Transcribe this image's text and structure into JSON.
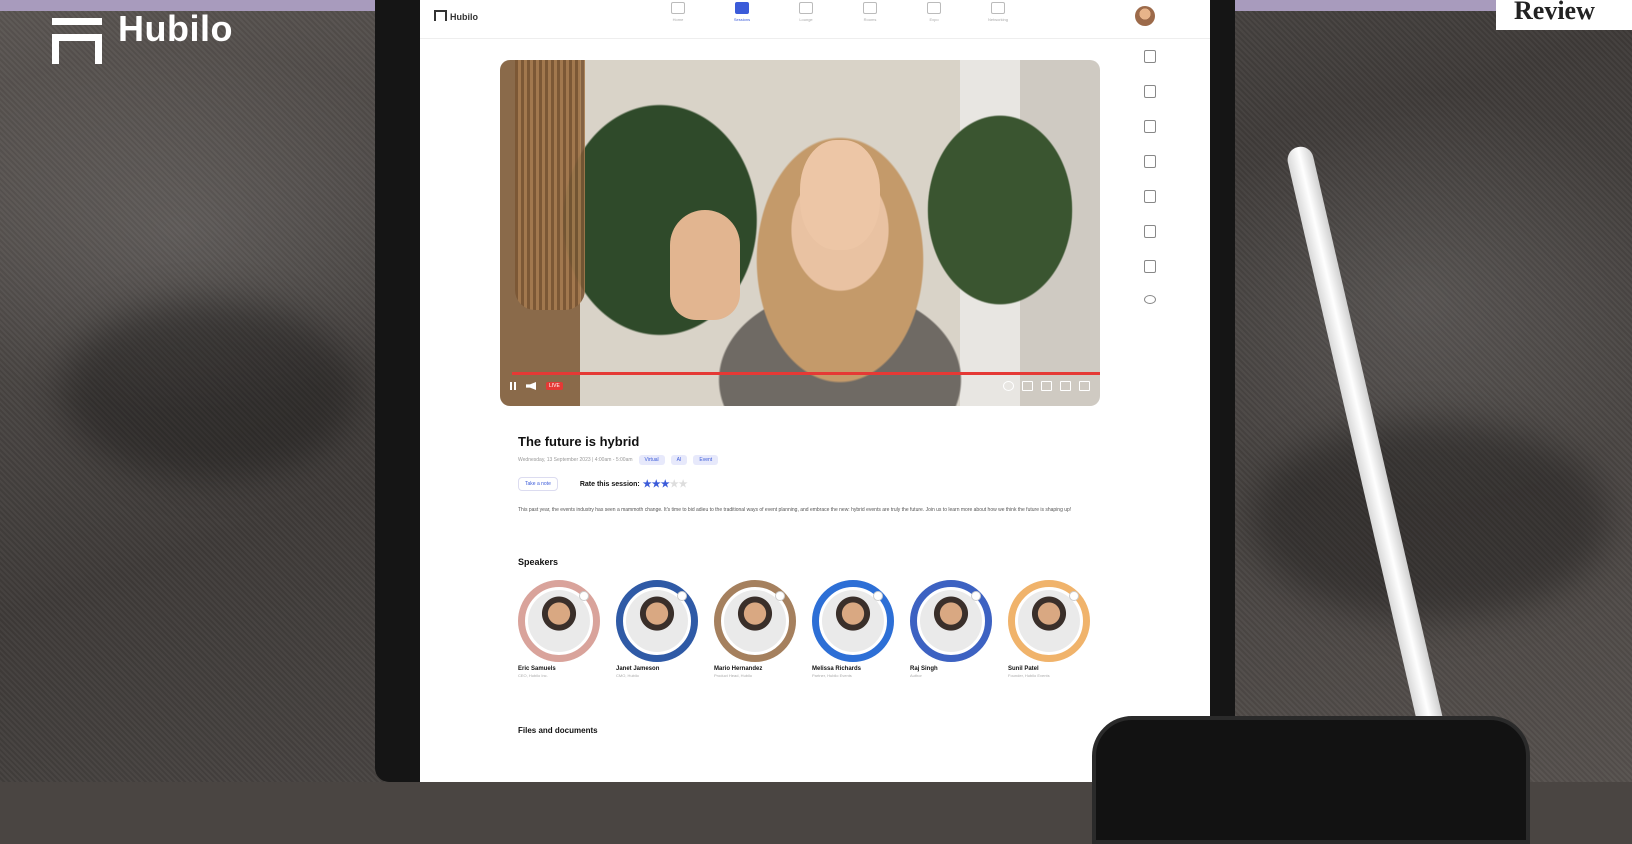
{
  "brand": {
    "name": "Hubilo"
  },
  "corner_label": "Review",
  "app": {
    "logo_text": "Hubilo",
    "nav_items": [
      {
        "label": "Home"
      },
      {
        "label": "Sessions"
      },
      {
        "label": "Lounge"
      },
      {
        "label": "Rooms"
      },
      {
        "label": "Expo"
      },
      {
        "label": "Networking"
      }
    ]
  },
  "video": {
    "live_label": "LIVE",
    "progress": 1.0
  },
  "session": {
    "title": "The future is hybrid",
    "meta_text": "Wednesday, 13 September 2023 | 4:00am - 5:00am",
    "tags": [
      "Virtual",
      "AI",
      "Event"
    ],
    "note_button": "Take a note",
    "rate_label": "Rate this session:",
    "rating": 3,
    "rating_max": 5,
    "description": "This past year, the events industry has seen a mammoth change. It's time to bid adieu to the traditional ways of event planning, and embrace the new: hybrid events are truly the future. Join us to learn more about how we think the future is shaping up!"
  },
  "speakers_heading": "Speakers",
  "speakers": [
    {
      "name": "Eric Samuels",
      "role": "CEO, Hubilo Inc.",
      "color": "#d9a39b"
    },
    {
      "name": "Janet Jameson",
      "role": "CMO, Hubilo",
      "color": "#2f5aa6"
    },
    {
      "name": "Mario Hernandez",
      "role": "Product Head, Hubilo",
      "color": "#a5805e"
    },
    {
      "name": "Melissa Richards",
      "role": "Partner, Hubilo Events",
      "color": "#2d6fd6"
    },
    {
      "name": "Raj Singh",
      "role": "Author",
      "color": "#3d62c2"
    },
    {
      "name": "Sunil Patel",
      "role": "Founder, Hubilo Events",
      "color": "#f0b36b"
    }
  ],
  "files_heading": "Files and documents"
}
